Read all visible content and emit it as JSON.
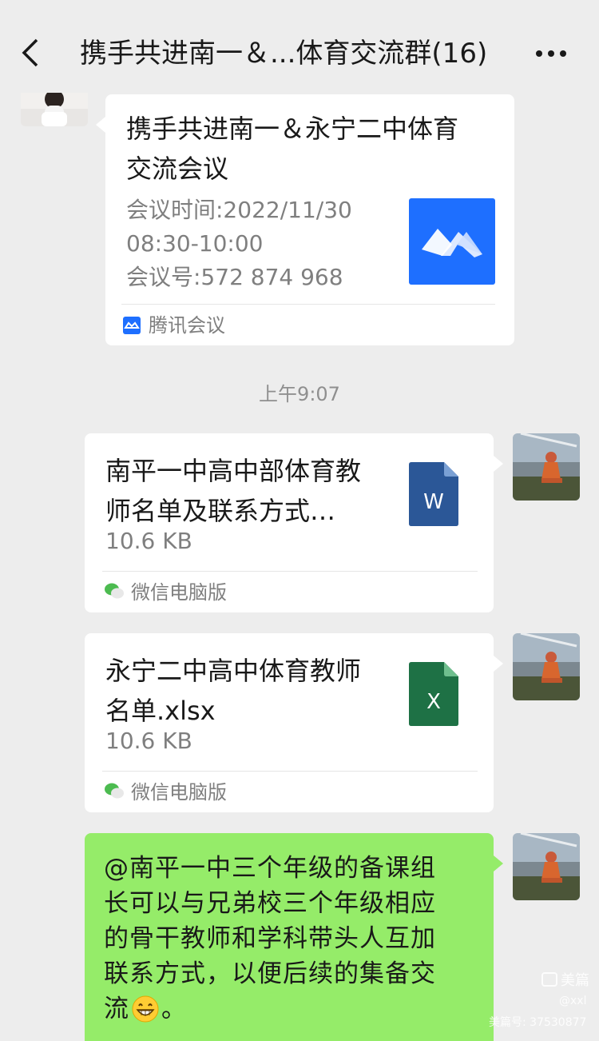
{
  "header": {
    "title": "携手共进南一＆...体育交流群(16)",
    "back_icon": "chevron-left-icon",
    "more_icon": "more-dots-icon"
  },
  "messages": {
    "meeting": {
      "title_line1": "携手共进南一＆永宁二中体育",
      "title_line2": "交流会议",
      "time_line1": "会议时间:2022/11/30",
      "time_line2": "08:30-10:00",
      "meeting_id": "会议号:572 874 968",
      "source": "腾讯会议",
      "app_color": "#1e6fff"
    },
    "timestamp": "上午9:07",
    "file1": {
      "name_line1": "南平一中高中部体育教",
      "name_line2": "师名单及联系方式…",
      "size": "10.6 KB",
      "source": "微信电脑版",
      "icon_letter": "W",
      "icon_color": "#2b5797"
    },
    "file2": {
      "name_line1": "永宁二中高中体育教师",
      "name_line2": "名单.xlsx",
      "size": "10.6 KB",
      "source": "微信电脑版",
      "icon_letter": "X",
      "icon_color": "#1e7145"
    },
    "text": {
      "line1": "@南平一中三个年级的备课组",
      "line2": "长可以与兄弟校三个年级相应",
      "line3": "的骨干教师和学科带头人互加",
      "line4": "联系方式，以便后续的集备交",
      "line5": "流",
      "line5_tail": "。",
      "emoji": "grinning-emoji",
      "bubble_color": "#95ec69"
    }
  },
  "watermark": {
    "brand": "美篇",
    "user": "@xxl",
    "id": "美篇号: 37530877"
  }
}
